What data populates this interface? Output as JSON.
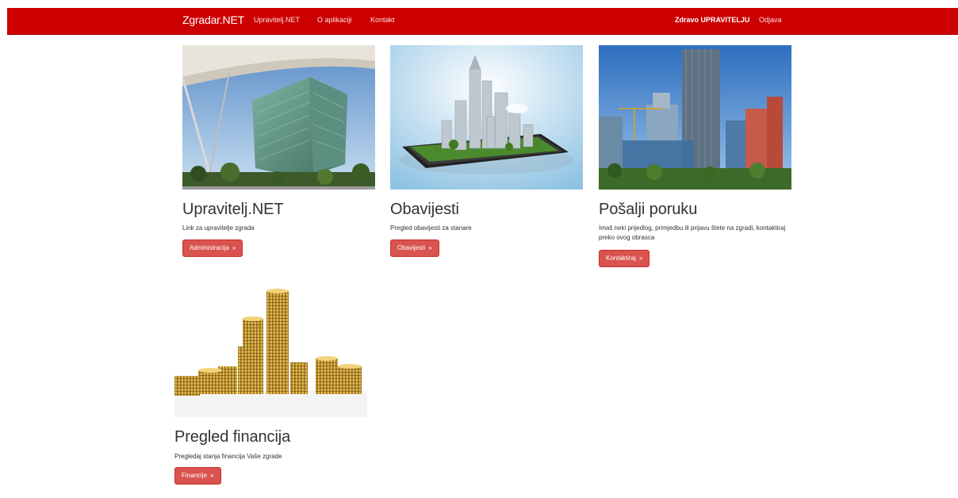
{
  "nav": {
    "brand": "Zgradar.NET",
    "links": [
      "Upravitelj.NET",
      "O aplikaciji",
      "Kontakt"
    ],
    "greeting": "Zdravo UPRAVITELJU",
    "logout": "Odjava"
  },
  "cards": [
    {
      "title": "Upravitelj.NET",
      "description": "Link za upravitelje zgrada",
      "button": "Administracija",
      "image_icon": "modern-building-image"
    },
    {
      "title": "Obavijesti",
      "description": "Pregled obavijesti za stanare",
      "button": "Obavijesti",
      "image_icon": "city-on-tablet-image"
    },
    {
      "title": "Pošalji poruku",
      "description": "Imaš neki prijedlog, primjedbu ili prijavu štete na zgradi, kontaktiraj preko ovog obrasca",
      "button": "Kontaktiraj",
      "image_icon": "skyscrapers-image"
    },
    {
      "title": "Pregled financija",
      "description": "Pregledaj stanja financija Vaše zgrade",
      "button": "Financije",
      "image_icon": "coin-stacks-image"
    }
  ],
  "button_arrow": "»",
  "colors": {
    "navbar": "#cc0000",
    "button": "#d9534f"
  }
}
